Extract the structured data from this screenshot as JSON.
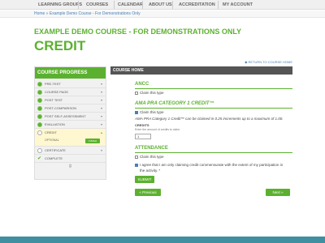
{
  "nav": {
    "items": [
      "LEARNING GROUPS",
      "COURSES",
      "CALENDAR",
      "ABOUT US",
      "ACCREDITATION",
      "MY ACCOUNT"
    ]
  },
  "breadcrumb": "Home » Example Demo Course - For Demonstrations Only",
  "page": {
    "course_title": "EXAMPLE DEMO COURSE - FOR DEMONSTRATIONS ONLY",
    "section_title": "CREDIT"
  },
  "sidebar": {
    "heading": "COURSE PROGRESS",
    "items": [
      {
        "label": "PRE-TEST"
      },
      {
        "label": "COURSE PAGE"
      },
      {
        "label": "POST TEST"
      },
      {
        "label": "POST-COMPARISON"
      },
      {
        "label": "POST SELF-ASSESSMENT"
      },
      {
        "label": "EVALUATION"
      },
      {
        "label": "CREDIT"
      },
      {
        "label": "CERTIFICATE"
      },
      {
        "label": "COMPLETE"
      }
    ],
    "optional_label": "OPTIONAL",
    "finish_label": "FINISH"
  },
  "main": {
    "header": "COURSE HOME",
    "return_link": "RETURN TO COURSE HOME",
    "ancc_title": "ANCC",
    "ancc_claim": "Claim this type",
    "ama_title": "AMA PRA CATEGORY 1 CREDIT™",
    "ama_claim": "Claim this type",
    "ama_desc": "AMA PRA Category 1 Credit™ can be claimed in 0.25 increments up to a maximum of 1.00.",
    "credits_label": "CREDITS",
    "credits_help": "Enter the amount of credits to claim.",
    "credits_value": "1",
    "attendance_title": "ATTENDANCE",
    "attendance_claim": "Claim this type",
    "attest_line1": "I agree that I am only claiming credit commensurate with the extent of my participation in",
    "attest_line2": "the activity. *",
    "submit_label": "SUBMIT",
    "prev_label": "« Previous",
    "next_label": "Next »"
  }
}
